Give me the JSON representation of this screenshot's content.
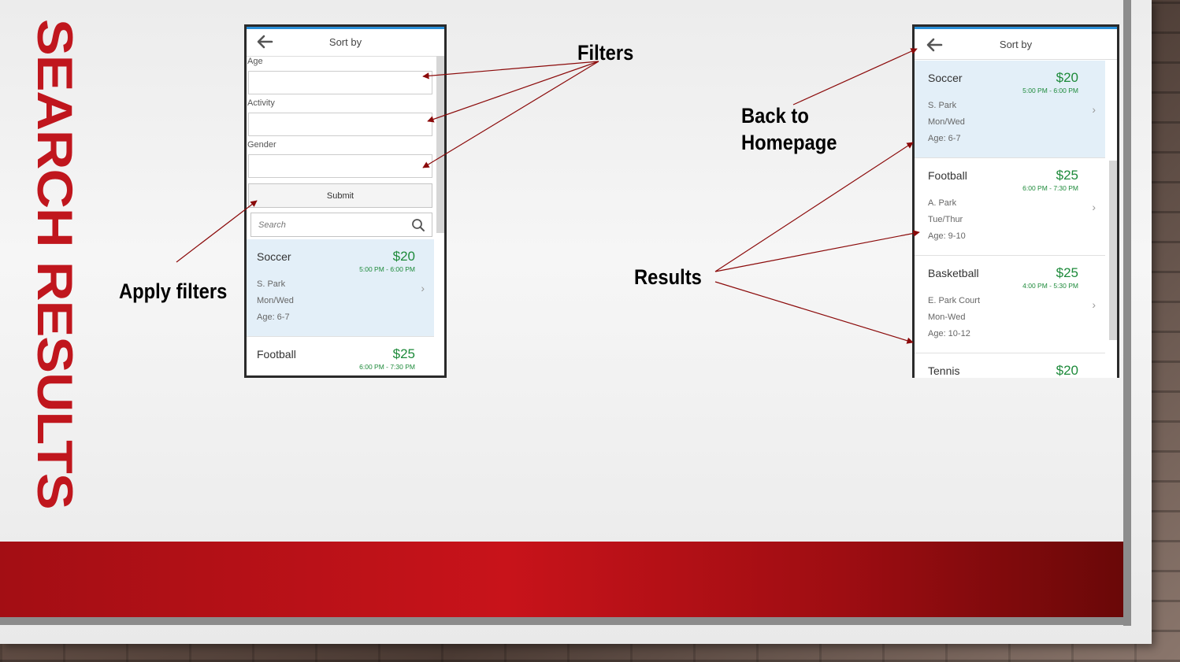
{
  "slide": {
    "title": "SEARCH RESULTS",
    "annotations": {
      "filters": "Filters",
      "apply_filters": "Apply filters",
      "back_home": "Back to Homepage",
      "results": "Results"
    },
    "colors": {
      "title_red": "#c0161d",
      "price_green": "#1d8a3a",
      "selected_row": "#e3eff8",
      "header_accent": "#2a8fd8",
      "arrow": "#8b0a0a"
    }
  },
  "screen_filters": {
    "header_title": "Sort by",
    "back_icon": "arrow-left-icon",
    "fields": [
      {
        "label": "Age",
        "value": ""
      },
      {
        "label": "Activity",
        "value": ""
      },
      {
        "label": "Gender",
        "value": ""
      }
    ],
    "submit_label": "Submit",
    "search_placeholder": "Search",
    "search_icon": "magnifier-icon",
    "results": [
      {
        "name": "Soccer",
        "price": "$20",
        "time": "5:00 PM - 6:00 PM",
        "location": "S. Park",
        "days": "Mon/Wed",
        "age": "Age: 6-7"
      },
      {
        "name": "Football",
        "price": "$25",
        "time": "6:00 PM - 7:30 PM"
      }
    ]
  },
  "screen_results": {
    "header_title": "Sort by",
    "back_icon": "arrow-left-icon",
    "results": [
      {
        "name": "Soccer",
        "price": "$20",
        "time": "5:00 PM - 6:00 PM",
        "location": "S. Park",
        "days": "Mon/Wed",
        "age": "Age: 6-7"
      },
      {
        "name": "Football",
        "price": "$25",
        "time": "6:00 PM - 7:30 PM",
        "location": "A. Park",
        "days": "Tue/Thur",
        "age": "Age: 9-10"
      },
      {
        "name": "Basketball",
        "price": "$25",
        "time": "4:00 PM - 5:30 PM",
        "location": "E. Park Court",
        "days": "Mon-Wed",
        "age": "Age: 10-12"
      },
      {
        "name": "Tennis",
        "price": "$20"
      }
    ]
  }
}
